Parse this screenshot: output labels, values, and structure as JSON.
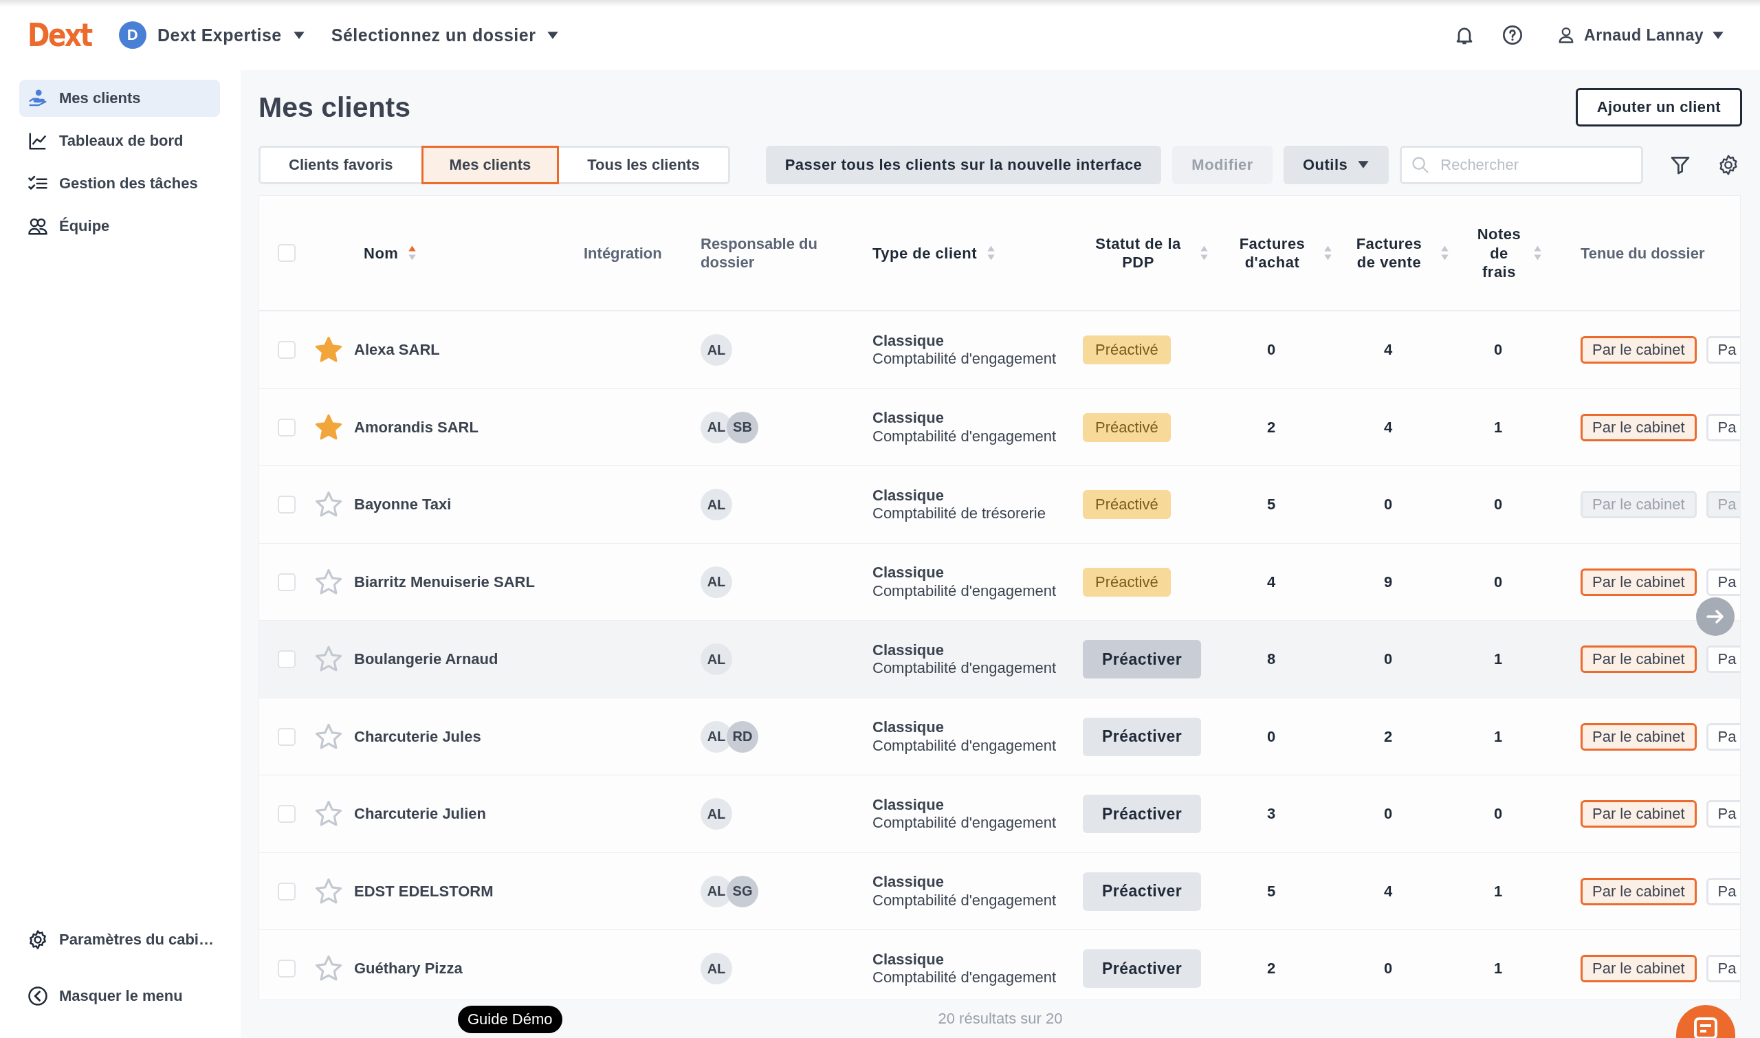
{
  "header": {
    "logo": "Dext",
    "org": {
      "initial": "D",
      "name": "Dext Expertise"
    },
    "folder_select": "Sélectionnez un dossier",
    "user": "Arnaud Lannay"
  },
  "sidebar": {
    "items": [
      {
        "label": "Mes clients",
        "selected": true,
        "kind": "clients"
      },
      {
        "label": "Tableaux de bord",
        "selected": false,
        "kind": "chart"
      },
      {
        "label": "Gestion des tâches",
        "selected": false,
        "kind": "tasks"
      },
      {
        "label": "Équipe",
        "selected": false,
        "kind": "team"
      }
    ],
    "footer_items": [
      {
        "label": "Paramètres du cabi…",
        "kind": "settings"
      },
      {
        "label": "Masquer le menu",
        "kind": "collapse"
      }
    ]
  },
  "page": {
    "title": "Mes clients",
    "add_button": "Ajouter un client"
  },
  "view_tabs": [
    {
      "label": "Clients favoris",
      "selected": false
    },
    {
      "label": "Mes clients",
      "selected": true
    },
    {
      "label": "Tous les clients",
      "selected": false
    }
  ],
  "toolbar": {
    "migrate_button": "Passer tous les clients sur la nouvelle interface",
    "edit_button": {
      "label": "Modifier",
      "disabled": true
    },
    "tools_button": "Outils",
    "search": {
      "placeholder": "Rechercher"
    }
  },
  "table": {
    "select_all": {
      "checked": false
    },
    "columns": [
      {
        "label": "Nom",
        "sortable": true,
        "sorted": true
      },
      {
        "label": "Intégration",
        "sortable": false
      },
      {
        "label": "Responsable du dossier",
        "sortable": false
      },
      {
        "label": "Type de client",
        "sortable": true,
        "sorted": false
      },
      {
        "label": "Statut de la PDP",
        "sortable": true,
        "sorted": false
      },
      {
        "label": "Factures d'achat",
        "sortable": true,
        "sorted": false
      },
      {
        "label": "Factures de vente",
        "sortable": true,
        "sorted": false
      },
      {
        "label": "Notes de frais",
        "sortable": true,
        "sorted": false
      },
      {
        "label": "Tenue du dossier",
        "sortable": false
      }
    ],
    "rows": [
      {
        "checked": false,
        "favorite": true,
        "hovered": false,
        "name": "Alexa SARL",
        "owners": [
          "AL"
        ],
        "client_type": "Classique",
        "accounting": "Comptabilité d'engagement",
        "pdp": {
          "kind": "badge",
          "label": "Préactivé"
        },
        "purchase_invoices": "0",
        "sales_invoices": "4",
        "expense_notes": "0",
        "keeping": {
          "disabled": false,
          "options": [
            {
              "label": "Par le cabinet",
              "selected": true
            },
            {
              "label": "Pa",
              "selected": false
            }
          ]
        }
      },
      {
        "checked": false,
        "favorite": true,
        "hovered": false,
        "name": "Amorandis SARL",
        "owners": [
          "AL",
          "SB"
        ],
        "client_type": "Classique",
        "accounting": "Comptabilité d'engagement",
        "pdp": {
          "kind": "badge",
          "label": "Préactivé"
        },
        "purchase_invoices": "2",
        "sales_invoices": "4",
        "expense_notes": "1",
        "keeping": {
          "disabled": false,
          "options": [
            {
              "label": "Par le cabinet",
              "selected": true
            },
            {
              "label": "Pa",
              "selected": false
            }
          ]
        }
      },
      {
        "checked": false,
        "favorite": false,
        "hovered": false,
        "name": "Bayonne Taxi",
        "owners": [
          "AL"
        ],
        "client_type": "Classique",
        "accounting": "Comptabilité de trésorerie",
        "pdp": {
          "kind": "badge",
          "label": "Préactivé"
        },
        "purchase_invoices": "5",
        "sales_invoices": "0",
        "expense_notes": "0",
        "keeping": {
          "disabled": true,
          "options": [
            {
              "label": "Par le cabinet",
              "selected": false
            },
            {
              "label": "Pa",
              "selected": false
            }
          ]
        }
      },
      {
        "checked": false,
        "favorite": false,
        "hovered": false,
        "name": "Biarritz Menuiserie SARL",
        "owners": [
          "AL"
        ],
        "client_type": "Classique",
        "accounting": "Comptabilité d'engagement",
        "pdp": {
          "kind": "badge",
          "label": "Préactivé"
        },
        "purchase_invoices": "4",
        "sales_invoices": "9",
        "expense_notes": "0",
        "keeping": {
          "disabled": false,
          "options": [
            {
              "label": "Par le cabinet",
              "selected": true
            },
            {
              "label": "Pa",
              "selected": false
            }
          ]
        }
      },
      {
        "checked": false,
        "favorite": false,
        "hovered": true,
        "name": "Boulangerie Arnaud",
        "owners": [
          "AL"
        ],
        "client_type": "Classique",
        "accounting": "Comptabilité d'engagement",
        "pdp": {
          "kind": "button",
          "label": "Préactiver"
        },
        "purchase_invoices": "8",
        "sales_invoices": "0",
        "expense_notes": "1",
        "keeping": {
          "disabled": false,
          "options": [
            {
              "label": "Par le cabinet",
              "selected": true
            },
            {
              "label": "Pa",
              "selected": false
            }
          ]
        }
      },
      {
        "checked": false,
        "favorite": false,
        "hovered": false,
        "name": "Charcuterie Jules",
        "owners": [
          "AL",
          "RD"
        ],
        "client_type": "Classique",
        "accounting": "Comptabilité d'engagement",
        "pdp": {
          "kind": "button",
          "label": "Préactiver"
        },
        "purchase_invoices": "0",
        "sales_invoices": "2",
        "expense_notes": "1",
        "keeping": {
          "disabled": false,
          "options": [
            {
              "label": "Par le cabinet",
              "selected": true
            },
            {
              "label": "Pa",
              "selected": false
            }
          ]
        }
      },
      {
        "checked": false,
        "favorite": false,
        "hovered": false,
        "name": "Charcuterie Julien",
        "owners": [
          "AL"
        ],
        "client_type": "Classique",
        "accounting": "Comptabilité d'engagement",
        "pdp": {
          "kind": "button",
          "label": "Préactiver"
        },
        "purchase_invoices": "3",
        "sales_invoices": "0",
        "expense_notes": "0",
        "keeping": {
          "disabled": false,
          "options": [
            {
              "label": "Par le cabinet",
              "selected": true
            },
            {
              "label": "Pa",
              "selected": false
            }
          ]
        }
      },
      {
        "checked": false,
        "favorite": false,
        "hovered": false,
        "name": "EDST EDELSTORM",
        "owners": [
          "AL",
          "SG"
        ],
        "client_type": "Classique",
        "accounting": "Comptabilité d'engagement",
        "pdp": {
          "kind": "button",
          "label": "Préactiver"
        },
        "purchase_invoices": "5",
        "sales_invoices": "4",
        "expense_notes": "1",
        "keeping": {
          "disabled": false,
          "options": [
            {
              "label": "Par le cabinet",
              "selected": true
            },
            {
              "label": "Pa",
              "selected": false
            }
          ]
        }
      },
      {
        "checked": false,
        "favorite": false,
        "hovered": false,
        "name": "Guéthary Pizza",
        "owners": [
          "AL"
        ],
        "client_type": "Classique",
        "accounting": "Comptabilité d'engagement",
        "pdp": {
          "kind": "button",
          "label": "Préactiver"
        },
        "purchase_invoices": "2",
        "sales_invoices": "0",
        "expense_notes": "1",
        "keeping": {
          "disabled": false,
          "options": [
            {
              "label": "Par le cabinet",
              "selected": true
            },
            {
              "label": "Pa",
              "selected": false
            }
          ]
        }
      }
    ]
  },
  "footer": {
    "results": "20 résultats sur 20",
    "guide_button": "Guide Démo"
  }
}
